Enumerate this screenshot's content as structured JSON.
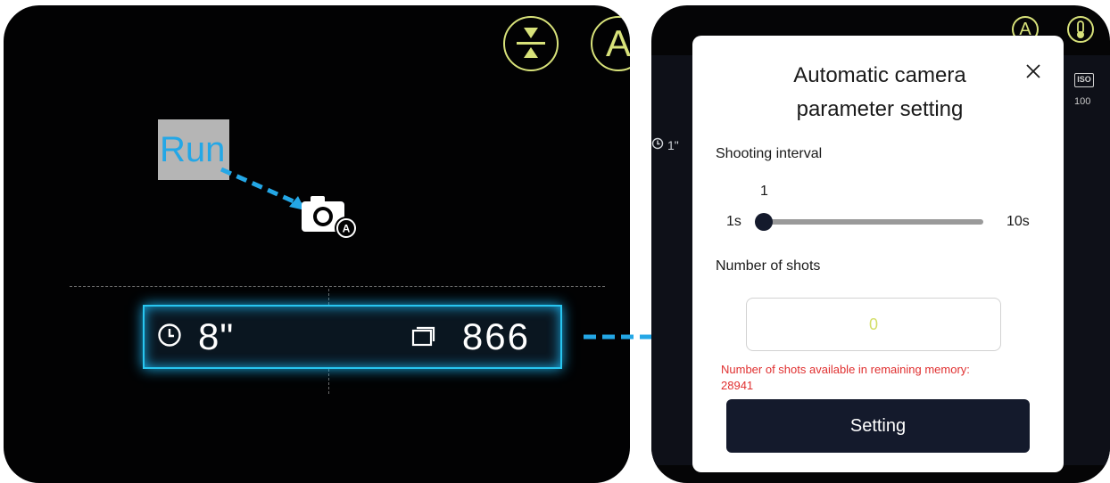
{
  "annotation": {
    "run_label": "Run",
    "accent_color": "#24a7e6"
  },
  "left_screen": {
    "top_icons": [
      "stack-compress-icon",
      "auto-mode-icon"
    ],
    "auto_letter": "A",
    "center_icon": "auto-camera-icon",
    "status_bar": {
      "interval_icon": "clock-icon",
      "interval_value": "8\"",
      "count_icon": "stacked-frames-icon",
      "count_value": "866"
    }
  },
  "right_screen": {
    "top_icons": [
      "auto-mode-icon",
      "thermometer-icon"
    ],
    "auto_letter": "A",
    "background_timer": "1\"",
    "iso_label": "ISO",
    "iso_value": "100",
    "dialog": {
      "title": "Automatic camera\nparameter setting",
      "close_icon": "close-icon",
      "shooting_interval_label": "Shooting interval",
      "slider": {
        "current": "1",
        "min_label": "1s",
        "max_label": "10s",
        "min": 1,
        "max": 10,
        "value": 1
      },
      "number_of_shots_label": "Number of shots",
      "shots_input_value": "0",
      "memory_note": "Number of shots available in remaining memory: 28941",
      "setting_button": "Setting"
    }
  },
  "colors": {
    "cyan_glow": "#28c6f0",
    "yellow_icon": "#d8e27a",
    "button_dark": "#141a2c",
    "error_red": "#e03030"
  }
}
